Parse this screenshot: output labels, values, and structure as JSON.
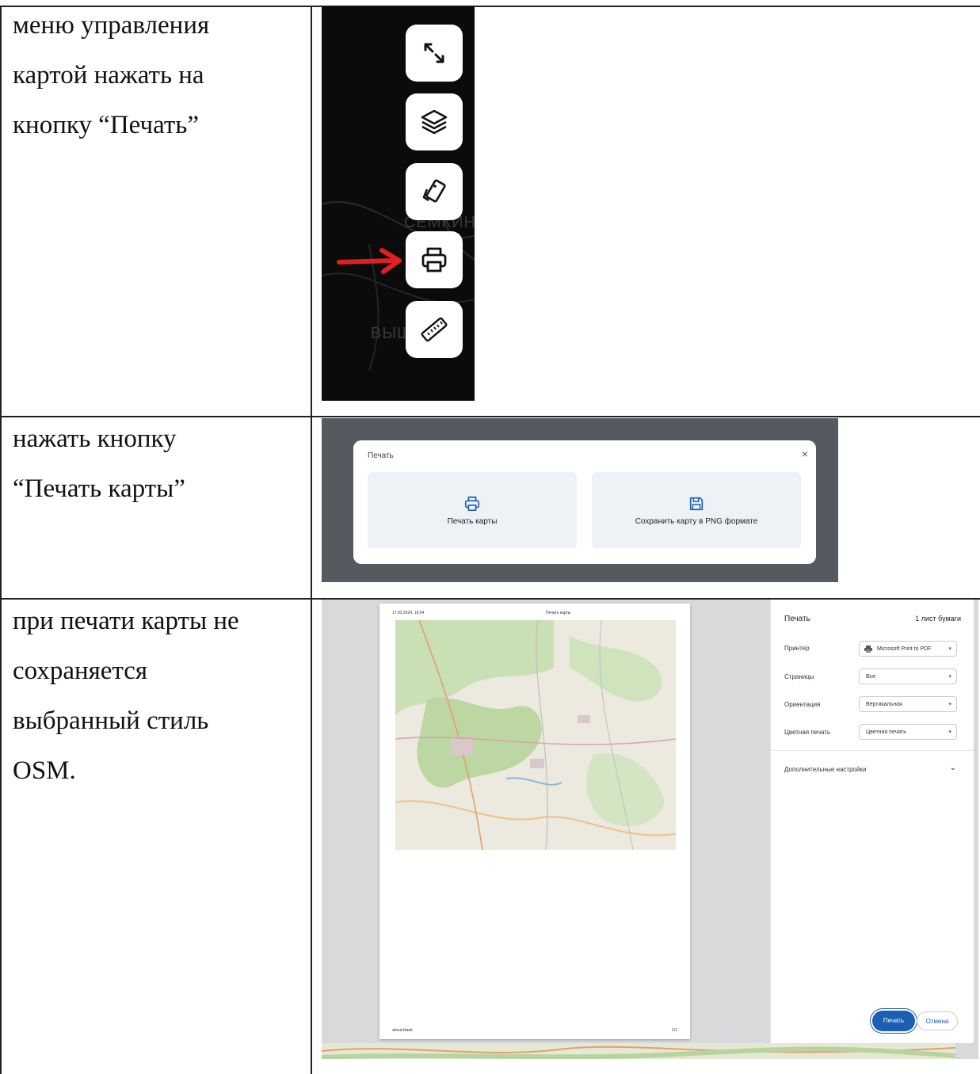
{
  "rows": [
    {
      "lines": [
        "меню управления",
        "картой нажать на",
        "кнопку “Печать”"
      ]
    },
    {
      "lines": [
        "нажать кнопку",
        "“Печать карты”"
      ]
    },
    {
      "lines": [
        "при печати карты не",
        "сохраняется",
        "выбранный стиль",
        "OSM."
      ]
    }
  ],
  "map_controls": {
    "buttons": [
      "expand-icon",
      "layers-icon",
      "style-icon",
      "printer-icon",
      "ruler-icon"
    ],
    "labels": {
      "top": "СЕМКИНО",
      "bottom": "ВЫШ"
    },
    "arrow_color": "#e02020"
  },
  "print_dialog": {
    "title": "Печать",
    "close": "×",
    "option_print": "Печать карты",
    "option_png": "Сохранить карту в PNG формате",
    "accent": "#1a5fb4"
  },
  "preview": {
    "date": "17.03.2024, 16:54",
    "page_title": "Печать карты",
    "url": "about:blank",
    "page_num": "1/1",
    "panel": {
      "title": "Печать",
      "sheets": "1 лист бумаги",
      "printer_label": "Принтер",
      "printer_value": "Microsoft Print to PDF",
      "pages_label": "Страницы",
      "pages_value": "Все",
      "orientation_label": "Ориентация",
      "orientation_value": "Вертикальная",
      "color_label": "Цветная печать",
      "color_value": "Цветная печать",
      "advanced": "Дополнительные настройки",
      "print_button": "Печать",
      "cancel_button": "Отмена"
    }
  }
}
